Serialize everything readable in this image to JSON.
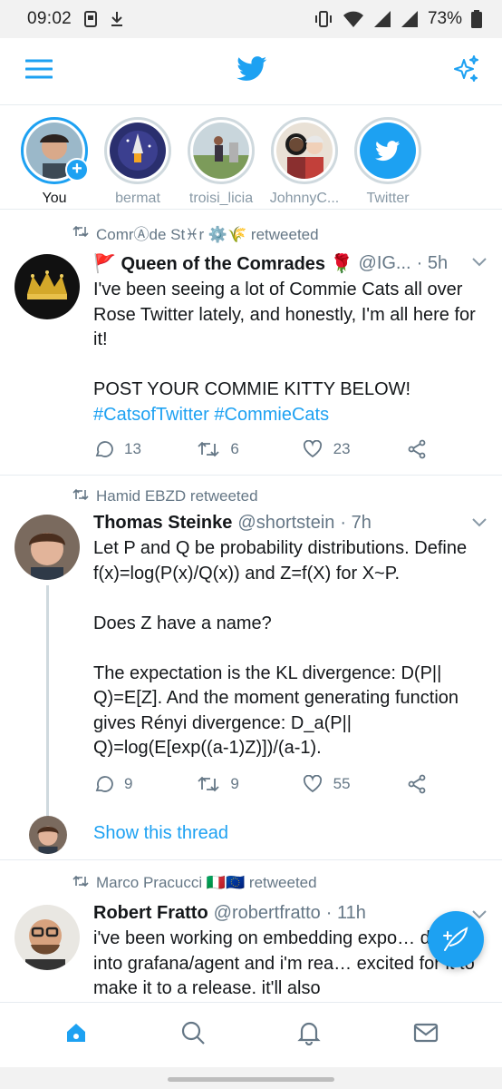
{
  "status_bar": {
    "time": "09:02",
    "battery": "73%"
  },
  "top_bar": {
    "menu_icon": "hamburger-icon",
    "logo_icon": "twitter-bird-icon",
    "sparkle_icon": "sparkle-icon"
  },
  "fleets": [
    {
      "label": "You"
    },
    {
      "label": "bermat"
    },
    {
      "label": "troisi_licia"
    },
    {
      "label": "JohnnyC..."
    },
    {
      "label": "Twitter"
    }
  ],
  "tweets": [
    {
      "retweeted_by": "ComrⒶde St♓r ⚙️🌾 retweeted",
      "name": "🚩 Queen of the Comrades 🌹",
      "handle": "@IG...",
      "time": "· 5h",
      "text_line1": "I've been seeing a lot of Commie Cats all over Rose Twitter lately, and honestly, I'm all here for it!\n\nPOST YOUR COMMIE KITTY BELOW!",
      "hashtags": "#CatsofTwitter #CommieCats",
      "replies": "13",
      "retweets": "6",
      "likes": "23"
    },
    {
      "retweeted_by": "Hamid EBZD retweeted",
      "name": "Thomas Steinke",
      "handle": "@shortstein",
      "time": "· 7h",
      "text": "Let P and Q be probability distributions. Define f(x)=log(P(x)/Q(x)) and Z=f(X) for X~P.\n\nDoes Z have a name?\n\nThe expectation is the KL divergence: D(P|| Q)=E[Z]. And the moment generating function gives Rényi divergence: D_a(P|| Q)=log(E[exp((a-1)Z)])/(a-1).",
      "replies": "9",
      "retweets": "9",
      "likes": "55",
      "show_thread": "Show this thread"
    },
    {
      "retweeted_by": "Marco Pracucci 🇮🇹🇪🇺 retweeted",
      "name": "Robert Fratto",
      "handle": "@robertfratto",
      "time": "· 11h",
      "text": "i've been working on embedding expo… directly into grafana/agent and i'm rea… excited for it to make it to a release. it'll also"
    }
  ],
  "bottom_nav": [
    "home-icon",
    "search-icon",
    "notifications-icon",
    "messages-icon"
  ],
  "colors": {
    "accent": "#1da1f2",
    "text": "#14171a",
    "muted": "#657786",
    "border": "#e6ecf0"
  }
}
